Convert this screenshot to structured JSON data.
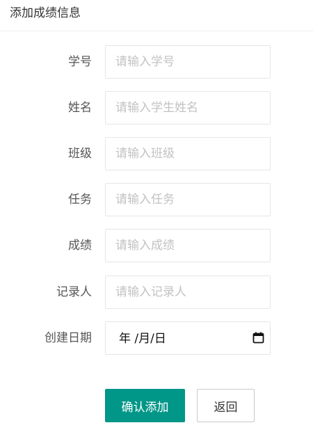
{
  "header": {
    "title": "添加成绩信息"
  },
  "form": {
    "fields": [
      {
        "label": "学号",
        "placeholder": "请输入学号",
        "value": ""
      },
      {
        "label": "姓名",
        "placeholder": "请输入学生姓名",
        "value": ""
      },
      {
        "label": "班级",
        "placeholder": "请输入班级",
        "value": ""
      },
      {
        "label": "任务",
        "placeholder": "请输入任务",
        "value": ""
      },
      {
        "label": "成绩",
        "placeholder": "请输入成绩",
        "value": ""
      },
      {
        "label": "记录人",
        "placeholder": "请输入记录人",
        "value": ""
      }
    ],
    "date": {
      "label": "创建日期",
      "display": "年 /月/日",
      "icon": "calendar-icon"
    }
  },
  "actions": {
    "confirm_label": "确认添加",
    "back_label": "返回"
  },
  "colors": {
    "primary": "#009688",
    "border": "#e6e6e6",
    "placeholder": "#c2c2c2"
  }
}
